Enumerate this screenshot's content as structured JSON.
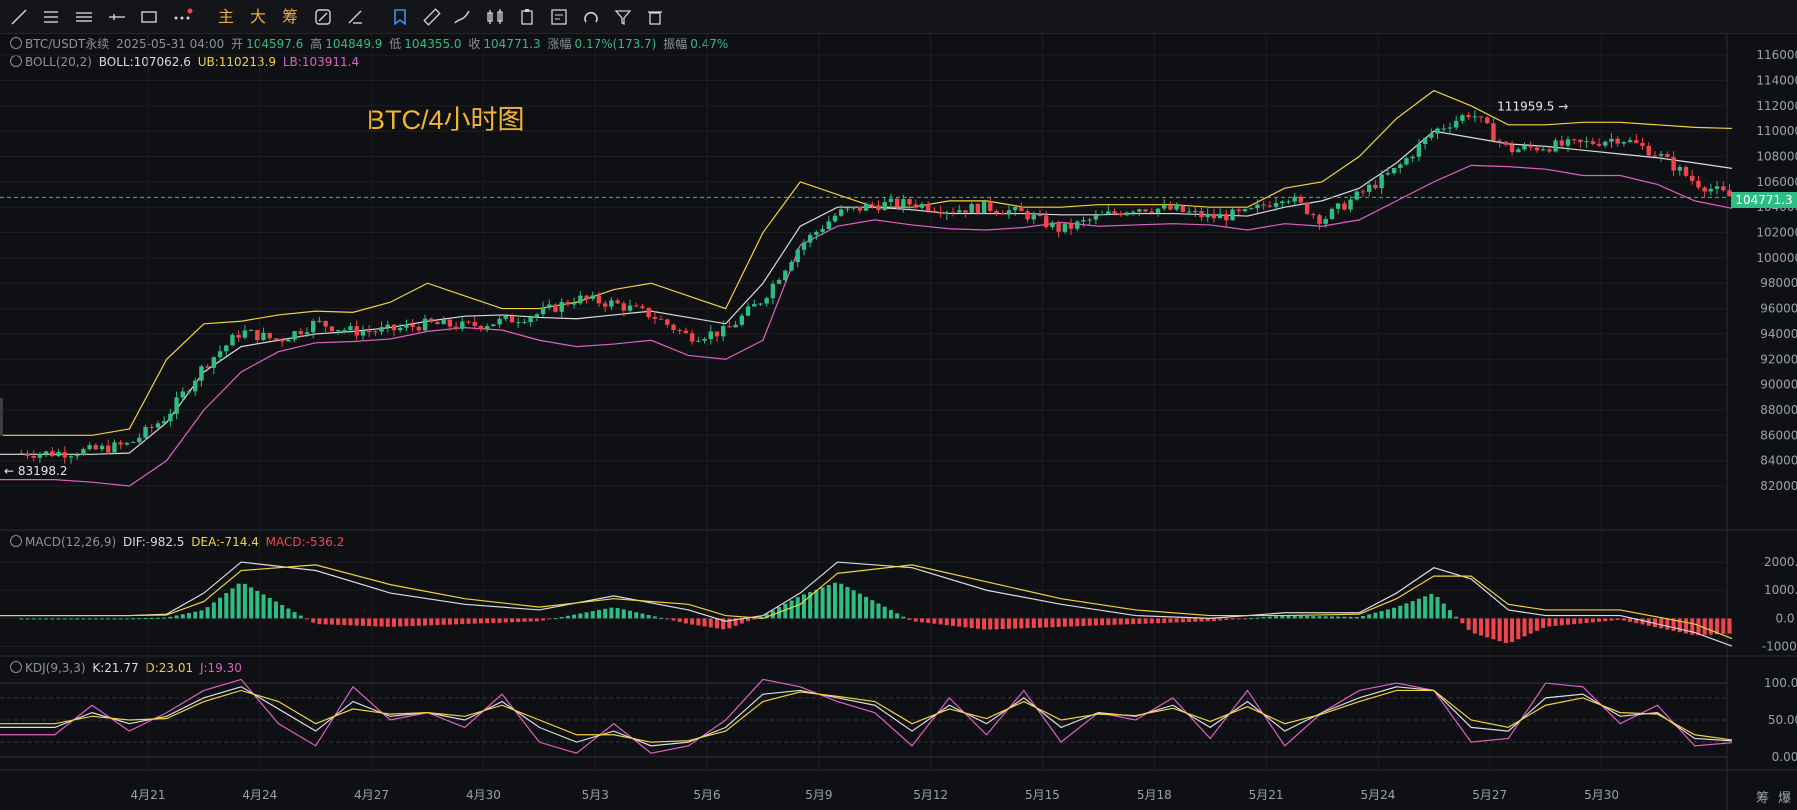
{
  "toolbar": {
    "tools": [
      "trend-line-icon",
      "horizontal-lines-icon",
      "parallel-lines-icon",
      "ray-icon",
      "rectangle-icon",
      "more-icon"
    ],
    "cn_buttons": [
      "主",
      "大",
      "筹"
    ],
    "right_tools": [
      "toggle-icon",
      "erase-icon",
      "bookmark-icon",
      "ruler-icon",
      "brush-icon",
      "candles-icon",
      "clipboard-icon",
      "note-icon",
      "magnet-icon",
      "filter-icon",
      "trash-icon"
    ]
  },
  "header": {
    "symbol": "BTC/USDT永续",
    "datetime": "2025-05-31 04:00",
    "open_label": "开",
    "open": "104597.6",
    "high_label": "高",
    "high": "104849.9",
    "low_label": "低",
    "low": "104355.0",
    "close_label": "收",
    "close": "104771.3",
    "change_label": "涨幅",
    "change": "0.17%(173.7)",
    "amp_label": "振幅",
    "amp": "0.47%"
  },
  "boll_legend": {
    "name": "BOLL(20,2)",
    "mid": "BOLL:107062.6",
    "ub": "UB:110213.9",
    "lb": "LB:103911.4"
  },
  "macd_legend": {
    "name": "MACD(12,26,9)",
    "dif": "DIF:-982.5",
    "dea": "DEA:-714.4",
    "macd": "MACD:-536.2"
  },
  "kdj_legend": {
    "name": "KDJ(9,3,3)",
    "k": "K:21.77",
    "d": "D:23.01",
    "j": "J:19.30"
  },
  "overlay_title": "BTC/4小时图",
  "annotations": {
    "high_mark": "111959.5",
    "low_mark": "83198.2"
  },
  "last_price_tag": "104771.3",
  "footer": {
    "right1": "筹",
    "right2": "爆"
  },
  "colors": {
    "up": "#2ebd85",
    "down": "#f0454b",
    "ub": "#f2d23a",
    "mid": "#d9dbe0",
    "lb": "#e05fc6",
    "bg": "#0f1014"
  },
  "chart_data": [
    {
      "type": "candlestick",
      "title": "BTC/USDT永续 4H",
      "x_ticks": [
        "4月21",
        "4月24",
        "4月27",
        "4月30",
        "5月3",
        "5月6",
        "5月9",
        "5月12",
        "5月15",
        "5月18",
        "5月21",
        "5月24",
        "5月27",
        "5月30"
      ],
      "y_ticks": [
        82000,
        84000,
        86000,
        88000,
        90000,
        92000,
        94000,
        96000,
        98000,
        100000,
        102000,
        104000,
        106000,
        108000,
        110000,
        112000,
        114000,
        116000
      ],
      "y_tick_labels": [
        "82000.0",
        "84000.0",
        "86000.0",
        "88000.0",
        "90000.0",
        "92000.0",
        "94000.0",
        "96000.0",
        "98000.0",
        "100000.0",
        "102000.0",
        "104000.0",
        "106000.0",
        "108000.0",
        "110000.0",
        "112000.0",
        "114000.0",
        "116000.0"
      ],
      "ylim": [
        80500,
        116800
      ],
      "series_anchors": {
        "x_day": [
          18.5,
          19.5,
          20.5,
          21.5,
          22.5,
          23.5,
          24.5,
          25.5,
          26.5,
          27.5,
          28.5,
          29.5,
          30.5,
          31.5,
          32.5,
          33.5,
          34.5,
          35.5,
          36.5,
          37.5,
          38.5,
          39.5,
          40.5,
          41.5,
          42.5,
          43.5,
          44.5,
          45.5,
          46.5,
          47.5,
          48.5,
          49.5,
          50.5,
          51.5,
          52.5,
          53.5,
          54.5,
          55.5,
          56.5,
          57.5,
          58.5,
          59.5,
          60.5,
          61.5,
          62.5,
          63.5
        ],
        "close": [
          84600,
          84800,
          85300,
          87500,
          91500,
          94200,
          93500,
          94900,
          94200,
          94300,
          94800,
          94600,
          95000,
          95600,
          96800,
          96400,
          95500,
          93800,
          94200,
          96800,
          101000,
          103500,
          104200,
          104300,
          103800,
          104000,
          103500,
          102200,
          103200,
          104000,
          103800,
          103200,
          103500,
          105000,
          103000,
          105000,
          107000,
          110000,
          111500,
          108500,
          108800,
          109000,
          109500,
          108200,
          106000,
          104771.3
        ]
      },
      "boll": {
        "ub": [
          86000,
          86000,
          86500,
          92000,
          94800,
          95000,
          95500,
          95800,
          95700,
          96500,
          98000,
          97000,
          96000,
          96000,
          96500,
          97500,
          98000,
          97000,
          96000,
          102000,
          106000,
          105000,
          104000,
          104000,
          104500,
          104500,
          104000,
          104000,
          104200,
          104200,
          104200,
          104000,
          104000,
          105500,
          106000,
          108000,
          111000,
          113200,
          112000,
          110500,
          110500,
          110700,
          110700,
          110500,
          110300,
          110213.9
        ],
        "mid": [
          84500,
          84500,
          84600,
          87000,
          91000,
          93000,
          93500,
          94000,
          94200,
          94500,
          95000,
          95400,
          95500,
          95300,
          95200,
          95500,
          95800,
          95300,
          94800,
          98000,
          102500,
          104000,
          104000,
          103800,
          103500,
          103500,
          103500,
          103400,
          103400,
          103500,
          103500,
          103400,
          103300,
          104000,
          104500,
          105500,
          107500,
          110000,
          109500,
          109000,
          108800,
          108500,
          108200,
          107900,
          107500,
          107062.6
        ],
        "lb": [
          82500,
          82300,
          82000,
          84000,
          88000,
          91000,
          92600,
          93300,
          93400,
          93600,
          94200,
          94500,
          94300,
          93500,
          93000,
          93200,
          93500,
          92300,
          92000,
          93500,
          101000,
          102500,
          103000,
          102600,
          102300,
          102200,
          102400,
          102800,
          102500,
          102600,
          102700,
          102600,
          102200,
          102700,
          102500,
          103000,
          104500,
          106000,
          107300,
          107200,
          107000,
          106500,
          106500,
          105800,
          104500,
          103911.4
        ]
      },
      "marked_high": 111959.5,
      "marked_low": 83198.2,
      "last_price": 104771.3
    },
    {
      "type": "bar",
      "title": "MACD(12,26,9)",
      "ylim": [
        -1300,
        2500
      ],
      "y_ticks": [
        -1000,
        0,
        1000,
        2000
      ],
      "y_tick_labels": [
        "-1000.0",
        "0.0",
        "1000.0",
        "2000.0"
      ],
      "x_day": [
        18.5,
        20.5,
        21.5,
        22.5,
        23.5,
        25.5,
        27.5,
        29.5,
        31.5,
        33.5,
        35.5,
        36.5,
        37.5,
        38.5,
        39.5,
        41.5,
        43.5,
        45.5,
        47.5,
        49.5,
        51.5,
        53.5,
        54.5,
        55.5,
        56.5,
        57.5,
        58.5,
        60.5,
        62.5,
        63.5
      ],
      "dif": [
        100,
        100,
        150,
        900,
        2000,
        1700,
        900,
        500,
        300,
        800,
        300,
        -100,
        100,
        900,
        2000,
        1800,
        1000,
        500,
        100,
        0,
        200,
        200,
        900,
        1800,
        1400,
        300,
        100,
        100,
        -500,
        -982.5
      ],
      "dea": [
        100,
        100,
        120,
        600,
        1700,
        1900,
        1200,
        700,
        400,
        700,
        500,
        100,
        0,
        500,
        1600,
        1900,
        1300,
        700,
        300,
        100,
        100,
        150,
        700,
        1500,
        1500,
        500,
        300,
        300,
        -200,
        -714.4
      ],
      "macd": [
        0,
        0,
        30,
        300,
        1300,
        -200,
        -300,
        -200,
        -100,
        400,
        -200,
        -400,
        100,
        800,
        1300,
        -100,
        -400,
        -300,
        -200,
        -100,
        100,
        50,
        400,
        900,
        -500,
        -900,
        -300,
        -50,
        -600,
        -536.2
      ]
    },
    {
      "type": "line",
      "title": "KDJ(9,3,3)",
      "ylim": [
        -15,
        115
      ],
      "y_ticks": [
        0,
        50,
        100
      ],
      "y_tick_labels": [
        "0.00",
        "50.00",
        "100.00"
      ],
      "x_day": [
        18.5,
        19.5,
        20.5,
        21.5,
        22.5,
        23.5,
        24.5,
        25.5,
        26.5,
        27.5,
        28.5,
        29.5,
        30.5,
        31.5,
        32.5,
        33.5,
        34.5,
        35.5,
        36.5,
        37.5,
        38.5,
        39.5,
        40.5,
        41.5,
        42.5,
        43.5,
        44.5,
        45.5,
        46.5,
        47.5,
        48.5,
        49.5,
        50.5,
        51.5,
        52.5,
        53.5,
        54.5,
        55.5,
        56.5,
        57.5,
        58.5,
        59.5,
        60.5,
        61.5,
        62.5,
        63.5
      ],
      "k": [
        40,
        60,
        45,
        55,
        80,
        95,
        65,
        35,
        75,
        55,
        60,
        50,
        75,
        40,
        20,
        35,
        15,
        20,
        40,
        85,
        90,
        80,
        70,
        35,
        70,
        45,
        80,
        40,
        60,
        55,
        70,
        40,
        75,
        35,
        60,
        80,
        95,
        90,
        40,
        35,
        80,
        85,
        55,
        60,
        25,
        21.77
      ],
      "d": [
        45,
        55,
        50,
        52,
        75,
        90,
        75,
        45,
        65,
        58,
        60,
        55,
        70,
        50,
        30,
        30,
        20,
        22,
        35,
        75,
        88,
        82,
        75,
        45,
        65,
        52,
        75,
        50,
        58,
        56,
        66,
        48,
        68,
        45,
        58,
        75,
        90,
        90,
        50,
        40,
        70,
        80,
        60,
        58,
        30,
        23.01
      ],
      "j": [
        30,
        70,
        35,
        60,
        90,
        105,
        45,
        15,
        95,
        50,
        60,
        40,
        85,
        20,
        5,
        45,
        5,
        15,
        50,
        105,
        95,
        75,
        60,
        15,
        80,
        30,
        90,
        20,
        60,
        50,
        80,
        25,
        90,
        15,
        60,
        90,
        100,
        90,
        20,
        25,
        100,
        95,
        45,
        70,
        15,
        19.3
      ]
    }
  ]
}
